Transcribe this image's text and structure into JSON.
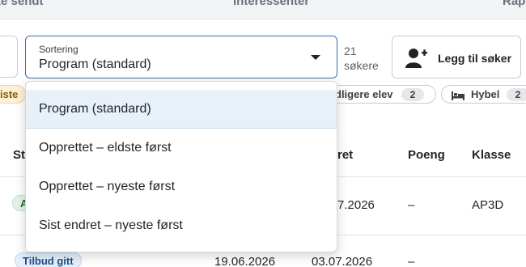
{
  "tabs": [
    {
      "label": "te sendt"
    },
    {
      "label": "Interessenter"
    },
    {
      "label": "Rap"
    }
  ],
  "sort": {
    "label": "Sortering",
    "value": "Program (standard)",
    "options": [
      "Program (standard)",
      "Opprettet – eldste først",
      "Opprettet – nyeste først",
      "Sist endret – nyeste først"
    ]
  },
  "results": {
    "count": "21",
    "unit": "søkere"
  },
  "add_button": {
    "label": "Legg til søker",
    "icon": "add-user-icon"
  },
  "filters": {
    "left_chip": "iste",
    "previous_student": {
      "label": "dligere elev",
      "count": "2"
    },
    "hybel": {
      "label": "Hybel",
      "count": "2",
      "icon": "bed-icon"
    }
  },
  "table": {
    "headers": [
      "St",
      "ret",
      "Poeng",
      "Klasse"
    ],
    "rows": [
      {
        "status": "A",
        "date2": "7.2026",
        "score": "–",
        "class": "AP3D"
      },
      {
        "status": "Tilbud gitt",
        "date1": "19.06.2026",
        "date2": "03.07.2026",
        "score": "–"
      }
    ]
  },
  "colors": {
    "accent": "#3a6ea5",
    "selected_bg": "#e8f1f8",
    "green_pill": "#e3f4e6",
    "blue_pill": "#e4effb"
  }
}
